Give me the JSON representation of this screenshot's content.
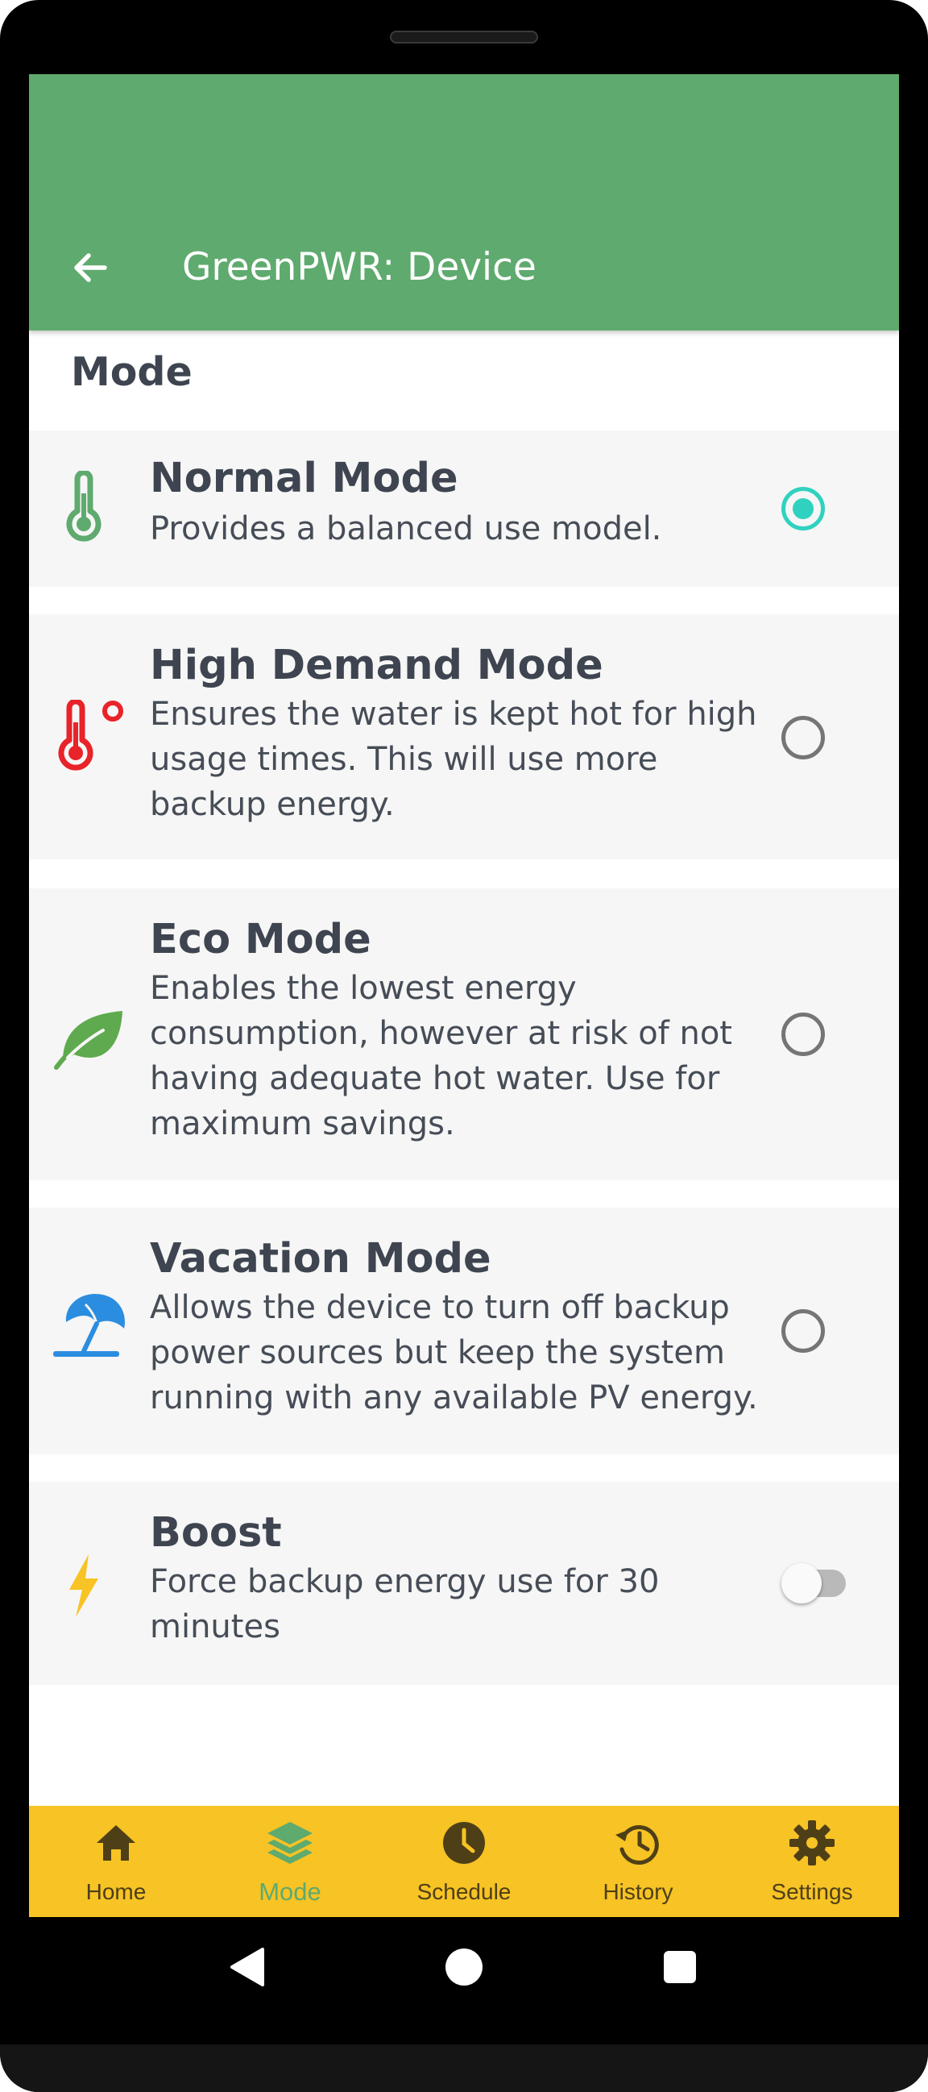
{
  "appbar": {
    "title": "GreenPWR: Device",
    "back_icon": "arrow-left-icon"
  },
  "section": {
    "title": "Mode"
  },
  "modes": [
    {
      "title": "Normal Mode",
      "description": "Provides a balanced use model.",
      "icon": "thermometer-icon",
      "icon_color": "#5faa6e",
      "selected": true
    },
    {
      "title": "High Demand Mode",
      "description": "Ensures the water is kept hot for high usage times. This will use more backup energy.",
      "icon": "thermometer-hot-icon",
      "icon_color": "#e8232a",
      "selected": false
    },
    {
      "title": "Eco Mode",
      "description": "Enables the lowest energy consumption, however at risk of not having adequate hot water. Use for maximum savings.",
      "icon": "leaf-icon",
      "icon_color": "#5faa4e",
      "selected": false
    },
    {
      "title": "Vacation Mode",
      "description": "Allows the device to turn off backup power sources but keep the system running with any available PV energy.",
      "icon": "beach-umbrella-icon",
      "icon_color": "#2b8de0",
      "selected": false
    }
  ],
  "boost": {
    "title": "Boost",
    "description": "Force backup energy use for 30 minutes",
    "icon": "lightning-bolt-icon",
    "icon_color": "#f7c325",
    "enabled": false
  },
  "bottom_nav": {
    "items": [
      {
        "label": "Home",
        "icon": "home-icon"
      },
      {
        "label": "Mode",
        "icon": "layers-icon",
        "active": true
      },
      {
        "label": "Schedule",
        "icon": "clock-icon"
      },
      {
        "label": "History",
        "icon": "history-icon"
      },
      {
        "label": "Settings",
        "icon": "gear-icon"
      }
    ]
  },
  "colors": {
    "appbar": "#5faa6e",
    "accent": "#2fd2bf",
    "bottom_nav": "#f7c325",
    "text": "#3e4550"
  }
}
